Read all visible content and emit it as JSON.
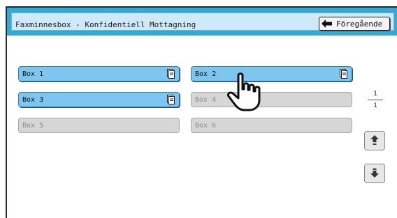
{
  "header": {
    "title": "Faxminnesbox - Konfidentiell Mottagning",
    "back_label": "Föregående"
  },
  "boxes": [
    {
      "label": "Box 1",
      "enabled": true,
      "has_doc": true
    },
    {
      "label": "Box 2",
      "enabled": true,
      "has_doc": true
    },
    {
      "label": "Box 3",
      "enabled": true,
      "has_doc": true
    },
    {
      "label": "Box 4",
      "enabled": false,
      "has_doc": false
    },
    {
      "label": "Box 5",
      "enabled": false,
      "has_doc": false
    },
    {
      "label": "Box 6",
      "enabled": false,
      "has_doc": false
    }
  ],
  "pagination": {
    "current": "1",
    "total": "1"
  },
  "colors": {
    "titlebar": "#35a9d5",
    "active_box": "#7cc6ef",
    "inactive_box": "#d6d6d6"
  }
}
